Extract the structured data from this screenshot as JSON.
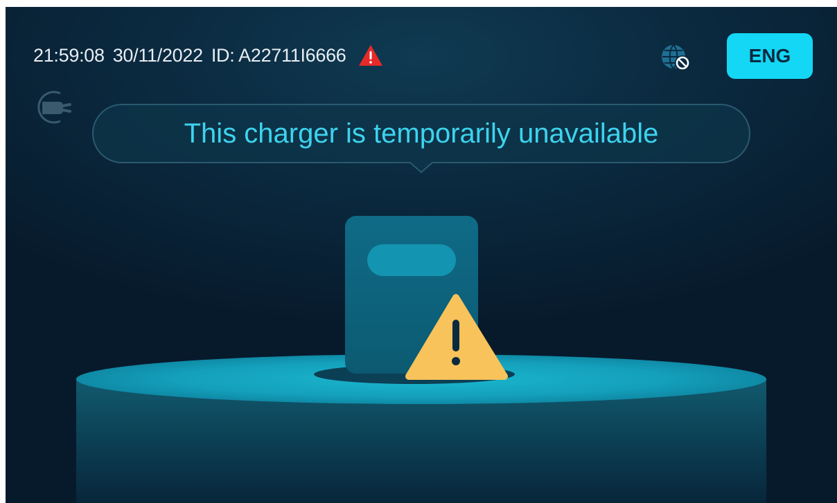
{
  "status_bar": {
    "time": "21:59:08",
    "date": "30/11/2022",
    "charger_id": "ID: A22711I6666",
    "alert_icon": "warning-triangle-icon",
    "network_icon": "network-offline-icon"
  },
  "language_button": {
    "label": "ENG"
  },
  "plug_status_icon": "ev-plug-icon",
  "message": {
    "text": "This charger is temporarily unavailable"
  },
  "illustration": {
    "warning_icon": "warning-triangle-icon"
  },
  "colors": {
    "background": "#0b2a40",
    "accent": "#13d7f5",
    "message_text": "#3ed3ee",
    "warning_red": "#e62a2a",
    "warning_yellow": "#f7c35a"
  }
}
